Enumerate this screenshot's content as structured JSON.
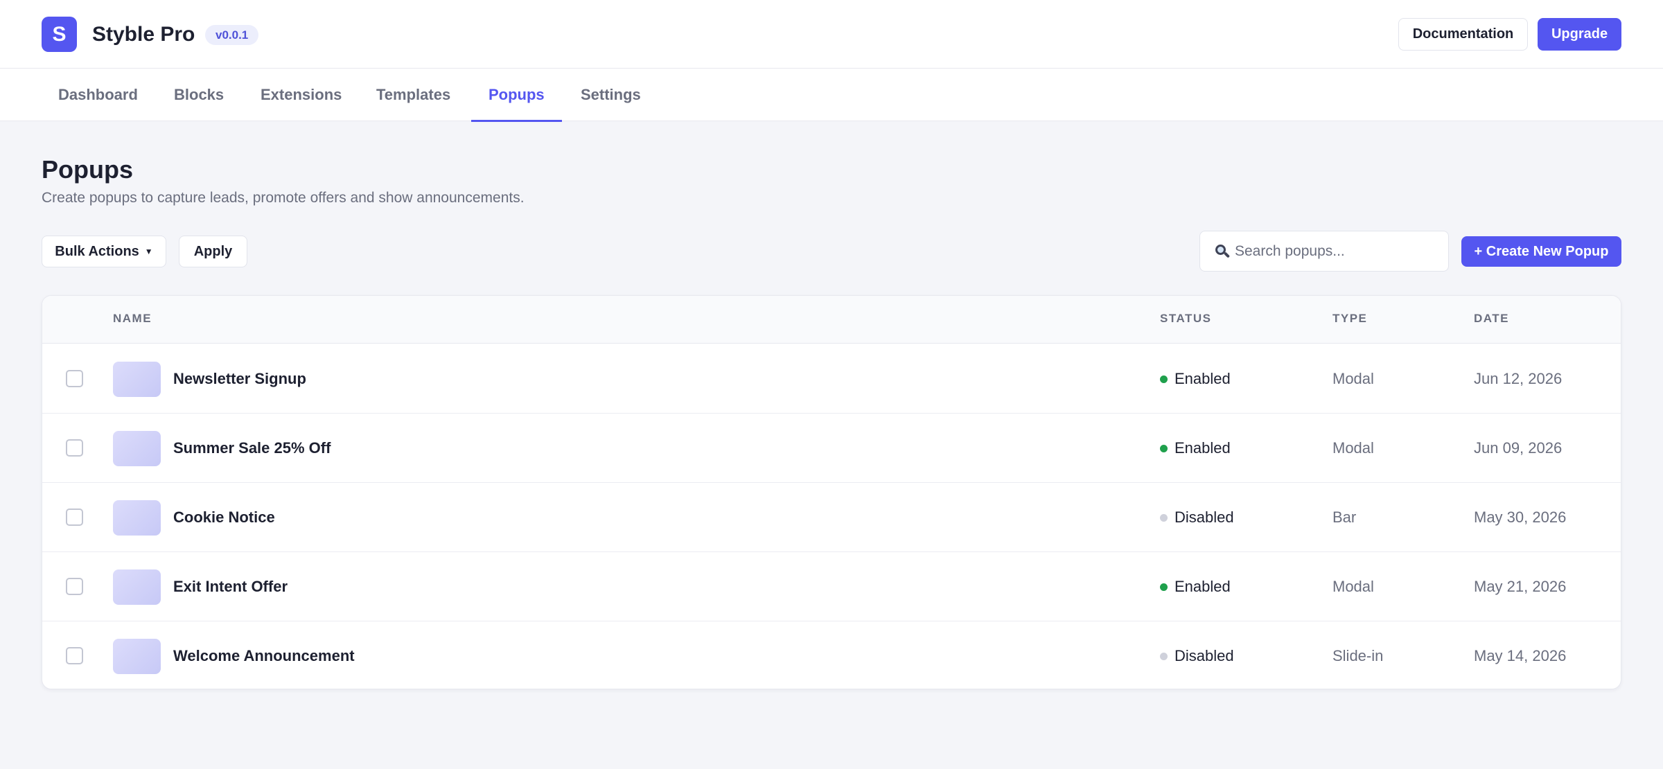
{
  "app": {
    "logo_letter": "S",
    "title": "Styble Pro",
    "version": "v0.0.1"
  },
  "header": {
    "documentation_label": "Documentation",
    "upgrade_label": "Upgrade"
  },
  "nav": {
    "tabs": [
      {
        "label": "Dashboard"
      },
      {
        "label": "Blocks"
      },
      {
        "label": "Extensions"
      },
      {
        "label": "Templates"
      },
      {
        "label": "Popups",
        "active": true
      },
      {
        "label": "Settings"
      }
    ]
  },
  "page": {
    "title": "Popups",
    "subtitle": "Create popups to capture leads, promote offers and show announcements."
  },
  "toolbar": {
    "bulk_actions_label": "Bulk Actions",
    "apply_label": "Apply",
    "search_placeholder": "Search popups...",
    "create_label": "+ Create New Popup"
  },
  "table": {
    "columns": {
      "name": "NAME",
      "status": "STATUS",
      "type": "TYPE",
      "date": "DATE"
    },
    "rows": [
      {
        "name": "Newsletter Signup",
        "status": "Enabled",
        "type": "Modal",
        "date": "Jun 12, 2026"
      },
      {
        "name": "Summer Sale 25% Off",
        "status": "Enabled",
        "type": "Modal",
        "date": "Jun 09, 2026"
      },
      {
        "name": "Cookie Notice",
        "status": "Disabled",
        "type": "Bar",
        "date": "May 30, 2026"
      },
      {
        "name": "Exit Intent Offer",
        "status": "Enabled",
        "type": "Modal",
        "date": "May 21, 2026"
      },
      {
        "name": "Welcome Announcement",
        "status": "Disabled",
        "type": "Slide-in",
        "date": "May 14, 2026"
      }
    ]
  },
  "colors": {
    "accent": "#5456f0",
    "enabled": "#1fa04c",
    "disabled": "#cfd1db"
  }
}
